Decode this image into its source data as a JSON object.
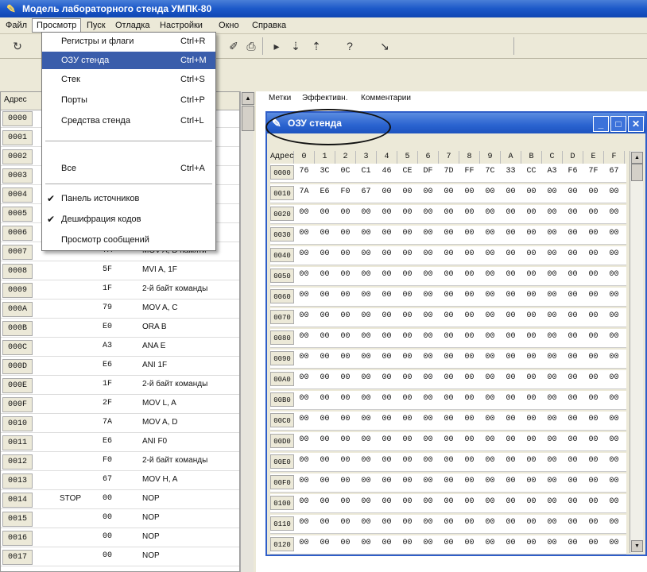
{
  "window": {
    "title": "Модель лабораторного стенда УМПК-80"
  },
  "menubar": [
    "Файл",
    "Просмотр",
    "Пуск",
    "Отладка",
    "Настройки",
    "Окно",
    "Справка"
  ],
  "menu": {
    "items": [
      {
        "label": "Регистры и флаги",
        "shortcut": "Ctrl+R",
        "checked": false
      },
      {
        "label": "ОЗУ стенда",
        "shortcut": "Ctrl+M",
        "checked": false,
        "selected": true
      },
      {
        "label": "Стек",
        "shortcut": "Ctrl+S",
        "checked": false
      },
      {
        "label": "Порты",
        "shortcut": "Ctrl+P",
        "checked": false
      },
      {
        "label": "Средства стенда",
        "shortcut": "Ctrl+L",
        "checked": false
      },
      {
        "label": "Все",
        "shortcut": "Ctrl+A",
        "checked": false
      },
      {
        "label": "Панель источников",
        "shortcut": "",
        "checked": true
      },
      {
        "label": "Дешифрация кодов",
        "shortcut": "",
        "checked": true
      },
      {
        "label": "Просмотр сообщений",
        "shortcut": "",
        "checked": false
      }
    ]
  },
  "left_pane": {
    "header": "Адрес",
    "rows": [
      {
        "addr": "0000",
        "label": "",
        "code": "",
        "cmd": ""
      },
      {
        "addr": "0001",
        "label": "",
        "code": "",
        "cmd": "ы"
      },
      {
        "addr": "0002",
        "label": "",
        "code": "",
        "cmd": ""
      },
      {
        "addr": "0003",
        "label": "",
        "code": "",
        "cmd": "ы"
      },
      {
        "addr": "0004",
        "label": "",
        "code": "",
        "cmd": ""
      },
      {
        "addr": "0005",
        "label": "",
        "code": "",
        "cmd": "ы"
      },
      {
        "addr": "0006",
        "label": "",
        "code": "",
        "cmd": ""
      },
      {
        "addr": "0007",
        "label": "",
        "code": "7А",
        "cmd": "MOV A, D памяти"
      },
      {
        "addr": "0008",
        "label": "",
        "code": "5F",
        "cmd": "MVI A, 1F"
      },
      {
        "addr": "0009",
        "label": "",
        "code": "1F",
        "cmd": "2-й байт команды"
      },
      {
        "addr": "000A",
        "label": "",
        "code": "79",
        "cmd": "MOV A, C"
      },
      {
        "addr": "000B",
        "label": "",
        "code": "E0",
        "cmd": "ORA B"
      },
      {
        "addr": "000C",
        "label": "",
        "code": "A3",
        "cmd": "ANA E"
      },
      {
        "addr": "000D",
        "label": "",
        "code": "E6",
        "cmd": "ANI 1F"
      },
      {
        "addr": "000E",
        "label": "",
        "code": "1F",
        "cmd": "2-й байт команды"
      },
      {
        "addr": "000F",
        "label": "",
        "code": "2F",
        "cmd": "MOV L, A"
      },
      {
        "addr": "0010",
        "label": "",
        "code": "7A",
        "cmd": "MOV A, D"
      },
      {
        "addr": "0011",
        "label": "",
        "code": "E6",
        "cmd": "ANI F0"
      },
      {
        "addr": "0012",
        "label": "",
        "code": "F0",
        "cmd": "2-й байт команды"
      },
      {
        "addr": "0013",
        "label": "",
        "code": "67",
        "cmd": "MOV H, A"
      },
      {
        "addr": "0014",
        "label": "STOP",
        "code": "00",
        "cmd": "NOP"
      },
      {
        "addr": "0015",
        "label": "",
        "code": "00",
        "cmd": "NOP"
      },
      {
        "addr": "0016",
        "label": "",
        "code": "00",
        "cmd": "NOP"
      },
      {
        "addr": "0017",
        "label": "",
        "code": "00",
        "cmd": "NOP"
      }
    ]
  },
  "right_tabs": [
    "Метки",
    "Эффективн.",
    "Комментарии"
  ],
  "memwin": {
    "title": "ОЗУ стенда",
    "header": [
      "Адрес",
      "0",
      "1",
      "2",
      "3",
      "4",
      "5",
      "6",
      "7",
      "8",
      "9",
      "A",
      "B",
      "C",
      "D",
      "E",
      "F"
    ],
    "rows": [
      {
        "addr": "0000",
        "cells": [
          "76",
          "3C",
          "0C",
          "C1",
          "46",
          "CE",
          "DF",
          "7D",
          "FF",
          "7C",
          "33",
          "CC",
          "A3",
          "F6",
          "7F",
          "67"
        ]
      },
      {
        "addr": "0010",
        "cells": [
          "7A",
          "E6",
          "F0",
          "67",
          "00",
          "00",
          "00",
          "00",
          "00",
          "00",
          "00",
          "00",
          "00",
          "00",
          "00",
          "00"
        ]
      },
      {
        "addr": "0020",
        "cells": [
          "00",
          "00",
          "00",
          "00",
          "00",
          "00",
          "00",
          "00",
          "00",
          "00",
          "00",
          "00",
          "00",
          "00",
          "00",
          "00"
        ]
      },
      {
        "addr": "0030",
        "cells": [
          "00",
          "00",
          "00",
          "00",
          "00",
          "00",
          "00",
          "00",
          "00",
          "00",
          "00",
          "00",
          "00",
          "00",
          "00",
          "00"
        ]
      },
      {
        "addr": "0040",
        "cells": [
          "00",
          "00",
          "00",
          "00",
          "00",
          "00",
          "00",
          "00",
          "00",
          "00",
          "00",
          "00",
          "00",
          "00",
          "00",
          "00"
        ]
      },
      {
        "addr": "0050",
        "cells": [
          "00",
          "00",
          "00",
          "00",
          "00",
          "00",
          "00",
          "00",
          "00",
          "00",
          "00",
          "00",
          "00",
          "00",
          "00",
          "00"
        ]
      },
      {
        "addr": "0060",
        "cells": [
          "00",
          "00",
          "00",
          "00",
          "00",
          "00",
          "00",
          "00",
          "00",
          "00",
          "00",
          "00",
          "00",
          "00",
          "00",
          "00"
        ]
      },
      {
        "addr": "0070",
        "cells": [
          "00",
          "00",
          "00",
          "00",
          "00",
          "00",
          "00",
          "00",
          "00",
          "00",
          "00",
          "00",
          "00",
          "00",
          "00",
          "00"
        ]
      },
      {
        "addr": "0080",
        "cells": [
          "00",
          "00",
          "00",
          "00",
          "00",
          "00",
          "00",
          "00",
          "00",
          "00",
          "00",
          "00",
          "00",
          "00",
          "00",
          "00"
        ]
      },
      {
        "addr": "0090",
        "cells": [
          "00",
          "00",
          "00",
          "00",
          "00",
          "00",
          "00",
          "00",
          "00",
          "00",
          "00",
          "00",
          "00",
          "00",
          "00",
          "00"
        ]
      },
      {
        "addr": "00A0",
        "cells": [
          "00",
          "00",
          "00",
          "00",
          "00",
          "00",
          "00",
          "00",
          "00",
          "00",
          "00",
          "00",
          "00",
          "00",
          "00",
          "00"
        ]
      },
      {
        "addr": "00B0",
        "cells": [
          "00",
          "00",
          "00",
          "00",
          "00",
          "00",
          "00",
          "00",
          "00",
          "00",
          "00",
          "00",
          "00",
          "00",
          "00",
          "00"
        ]
      },
      {
        "addr": "00C0",
        "cells": [
          "00",
          "00",
          "00",
          "00",
          "00",
          "00",
          "00",
          "00",
          "00",
          "00",
          "00",
          "00",
          "00",
          "00",
          "00",
          "00"
        ]
      },
      {
        "addr": "00D0",
        "cells": [
          "00",
          "00",
          "00",
          "00",
          "00",
          "00",
          "00",
          "00",
          "00",
          "00",
          "00",
          "00",
          "00",
          "00",
          "00",
          "00"
        ]
      },
      {
        "addr": "00E0",
        "cells": [
          "00",
          "00",
          "00",
          "00",
          "00",
          "00",
          "00",
          "00",
          "00",
          "00",
          "00",
          "00",
          "00",
          "00",
          "00",
          "00"
        ]
      },
      {
        "addr": "00F0",
        "cells": [
          "00",
          "00",
          "00",
          "00",
          "00",
          "00",
          "00",
          "00",
          "00",
          "00",
          "00",
          "00",
          "00",
          "00",
          "00",
          "00"
        ]
      },
      {
        "addr": "0100",
        "cells": [
          "00",
          "00",
          "00",
          "00",
          "00",
          "00",
          "00",
          "00",
          "00",
          "00",
          "00",
          "00",
          "00",
          "00",
          "00",
          "00"
        ]
      },
      {
        "addr": "0110",
        "cells": [
          "00",
          "00",
          "00",
          "00",
          "00",
          "00",
          "00",
          "00",
          "00",
          "00",
          "00",
          "00",
          "00",
          "00",
          "00",
          "00"
        ]
      },
      {
        "addr": "0120",
        "cells": [
          "00",
          "00",
          "00",
          "00",
          "00",
          "00",
          "00",
          "00",
          "00",
          "00",
          "00",
          "00",
          "00",
          "00",
          "00",
          "00"
        ]
      }
    ]
  },
  "colors": {
    "title_bar": "#1c58c8",
    "menu_highlight": "#3a5dab"
  },
  "icons": [
    "app-icon",
    "open-icon",
    "save-icon",
    "print-icon",
    "run-icon",
    "step-icon",
    "step-over-icon",
    "help-icon",
    "pointer-icon"
  ]
}
